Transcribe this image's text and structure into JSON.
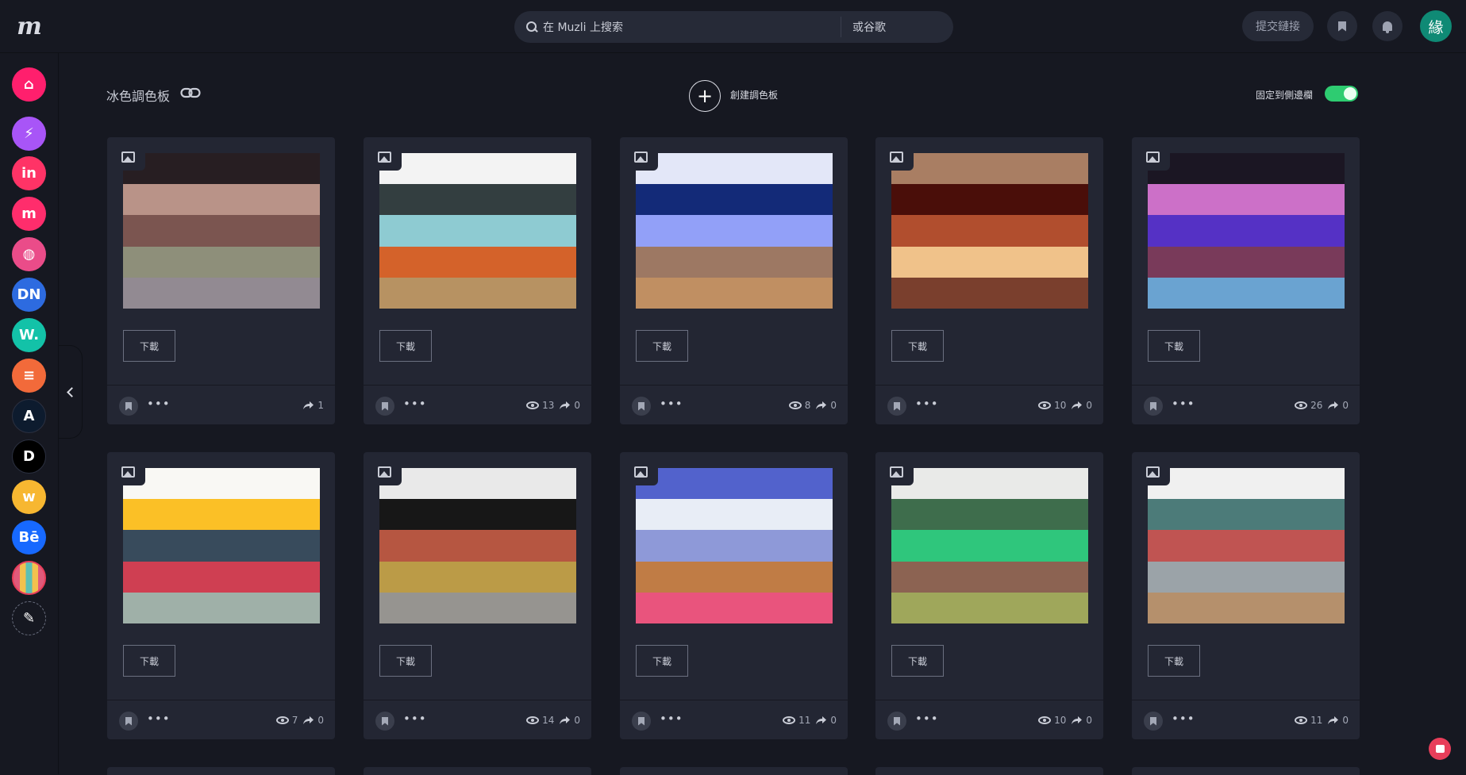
{
  "header": {
    "logo_text": "m",
    "search_placeholder": "在 Muzli 上搜索",
    "search_alt": "或谷歌",
    "submit_link": "提交鏈接",
    "avatar_text": "緣"
  },
  "sidebar": {
    "items": [
      {
        "name": "home",
        "text": "⌂",
        "color": "#ff1f6d"
      },
      {
        "name": "bolt",
        "text": "⚡",
        "color": "#a855f7"
      },
      {
        "name": "invision",
        "text": "in",
        "color": "#ff3366"
      },
      {
        "name": "muzli",
        "text": "m",
        "color": "#ff2d6c"
      },
      {
        "name": "dribbble",
        "text": "◍",
        "color": "#ea4c89"
      },
      {
        "name": "designer-news",
        "text": "DN",
        "color": "#2d6be0"
      },
      {
        "name": "webdesigner",
        "text": "W.",
        "color": "#13c2a8"
      },
      {
        "name": "sitepoint",
        "text": "≡",
        "color": "#f26a3a"
      },
      {
        "name": "affinity",
        "text": "A",
        "color": "#0d1b2e"
      },
      {
        "name": "dev",
        "text": "D",
        "color": "#000000"
      },
      {
        "name": "webflow",
        "text": "w",
        "color": "#f7b731"
      },
      {
        "name": "behance",
        "text": "Bē",
        "color": "#1769ff"
      },
      {
        "name": "palettes",
        "text": "",
        "color": "#e83e5a"
      },
      {
        "name": "edit",
        "text": "✎",
        "color": "#161821"
      }
    ]
  },
  "page": {
    "title": "冰色調色板",
    "create_label": "創建調色板",
    "pin_label": "固定到側邊欄",
    "pin_enabled": true
  },
  "cards": [
    {
      "colors": [
        "#271e22",
        "#b99388",
        "#7b5550",
        "#8e8f7a",
        "#928a92"
      ],
      "download": "下載",
      "views": "",
      "shares": "1"
    },
    {
      "colors": [
        "#f3f3f3",
        "#333e40",
        "#8ecbd2",
        "#d4622a",
        "#b79262"
      ],
      "download": "下載",
      "views": "13",
      "shares": "0"
    },
    {
      "colors": [
        "#e3e7f8",
        "#132a78",
        "#92a0f8",
        "#9d7863",
        "#c08f62"
      ],
      "download": "下載",
      "views": "8",
      "shares": "0"
    },
    {
      "colors": [
        "#a97e63",
        "#4a0e09",
        "#b14e2e",
        "#f0c28a",
        "#7a3f2d"
      ],
      "download": "下載",
      "views": "10",
      "shares": "0"
    },
    {
      "colors": [
        "#1b1623",
        "#cc70c8",
        "#5531c5",
        "#793a5a",
        "#6aa3d1"
      ],
      "download": "下載",
      "views": "26",
      "shares": "0"
    },
    {
      "colors": [
        "#f9f8f4",
        "#fbc026",
        "#384b5c",
        "#cf3f52",
        "#9fb0a8"
      ],
      "download": "下載",
      "views": "7",
      "shares": "0"
    },
    {
      "colors": [
        "#e9e9e9",
        "#171717",
        "#b65641",
        "#bb9b47",
        "#969490"
      ],
      "download": "下載",
      "views": "14",
      "shares": "0"
    },
    {
      "colors": [
        "#5262cc",
        "#e8edf6",
        "#8e99d8",
        "#c07c45",
        "#e9547d"
      ],
      "download": "下載",
      "views": "11",
      "shares": "0"
    },
    {
      "colors": [
        "#e9eae8",
        "#3e6d4c",
        "#2fc67c",
        "#8c6352",
        "#9fa75b"
      ],
      "download": "下載",
      "views": "10",
      "shares": "0"
    },
    {
      "colors": [
        "#f0f0f0",
        "#4c7b79",
        "#c05452",
        "#9ba3a8",
        "#b5906c"
      ],
      "download": "下載",
      "views": "11",
      "shares": "0"
    }
  ]
}
